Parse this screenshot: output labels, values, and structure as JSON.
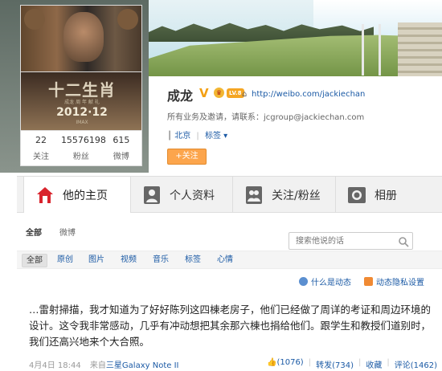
{
  "profile": {
    "name": "成龙",
    "verified": "V",
    "level": "LV.8",
    "homepage": "http://weibo.com/jackiechan",
    "biz_text": "所有业务及邀请，请联系：jcgroup@jackiechan.com",
    "location": "北京",
    "tag_label": "标签",
    "follow_label": "+关注"
  },
  "poster": {
    "title": "十二生肖",
    "subtitle": "成龙  周 年 献 礼",
    "date": "2012·12",
    "imax": "IMAX"
  },
  "stats": [
    {
      "value": "22",
      "label": "关注"
    },
    {
      "value": "15576198",
      "label": "粉丝"
    },
    {
      "value": "615",
      "label": "微博"
    }
  ],
  "nav": {
    "tabs": [
      {
        "label": "他的主页",
        "icon": "home-icon"
      },
      {
        "label": "个人资料",
        "icon": "person-icon"
      },
      {
        "label": "关注/粉丝",
        "icon": "people-icon"
      },
      {
        "label": "相册",
        "icon": "camera-icon"
      }
    ]
  },
  "feed": {
    "sub_tabs": [
      "全部",
      "微博"
    ],
    "search_placeholder": "搜索他说的话",
    "filters": [
      "全部",
      "原创",
      "图片",
      "视频",
      "音乐",
      "标签",
      "心情"
    ],
    "tools": {
      "what_is": "什么是动态",
      "filter_setting": "动态隐私设置"
    },
    "post": {
      "lines": [
        "…雷射掃描，我才知道为了好好陈列这四棟老房子，他们已经做了周详的考证和周边环境的",
        "设计。这令我非常感动，几乎有冲动想把其余那六棟也捐给他们。跟学生和教授们道别时，",
        "我们还高兴地来个大合照。"
      ],
      "time": "4月4日 18:44",
      "source_prefix": "来自",
      "source": "三星Galaxy Note II",
      "likes": "(1076)",
      "repost": "转发(734)",
      "favorite": "收藏",
      "comment": "评论(1462)"
    }
  },
  "colors": {
    "link": "#1b5aa5",
    "follow": "#fca54c",
    "vbadge": "#f3a014",
    "home_active": "#d9242d"
  }
}
